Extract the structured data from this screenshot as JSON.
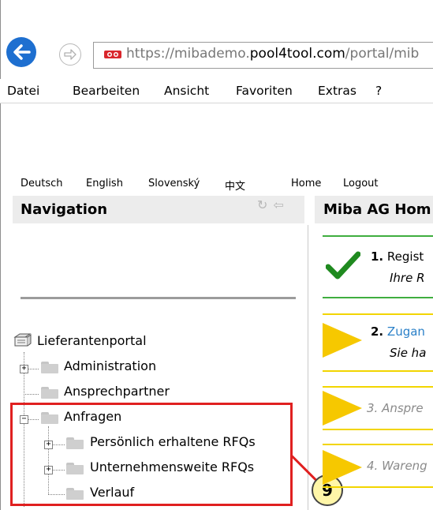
{
  "browser": {
    "url_prefix": "https://",
    "url_host_sub": "mibademo.",
    "url_host_main": "pool4tool.com",
    "url_path": "/portal/mib",
    "menu": [
      "Datei",
      "Bearbeiten",
      "Ansicht",
      "Favoriten",
      "Extras",
      "?"
    ]
  },
  "portal": {
    "languages": [
      "Deutsch",
      "English",
      "Slovenský",
      "中文"
    ],
    "links": [
      "Home",
      "Logout"
    ],
    "nav_title": "Navigation",
    "main_title": "Miba AG Hom",
    "tree": {
      "root": "Lieferantenportal",
      "items": [
        "Administration",
        "Ansprechpartner",
        "Anfragen"
      ],
      "sub_items": [
        "Persönlich erhaltene RFQs",
        "Unternehmensweite RFQs",
        "Verlauf"
      ]
    },
    "callout_number": "9",
    "steps": [
      {
        "num": "1.",
        "title": "Regist",
        "sub": "Ihre R"
      },
      {
        "num": "2.",
        "title": "Zugan",
        "sub": "Sie ha"
      },
      {
        "num": "",
        "title": "3. Anspre",
        "sub": ""
      },
      {
        "num": "",
        "title": "4. Wareng",
        "sub": ""
      }
    ]
  },
  "colors": {
    "accent_blue": "#1e6fd0",
    "check_green": "#1f8a1f",
    "step_yellow": "#f6c800",
    "highlight_red": "#e02020",
    "link_blue": "#2a80c8"
  }
}
